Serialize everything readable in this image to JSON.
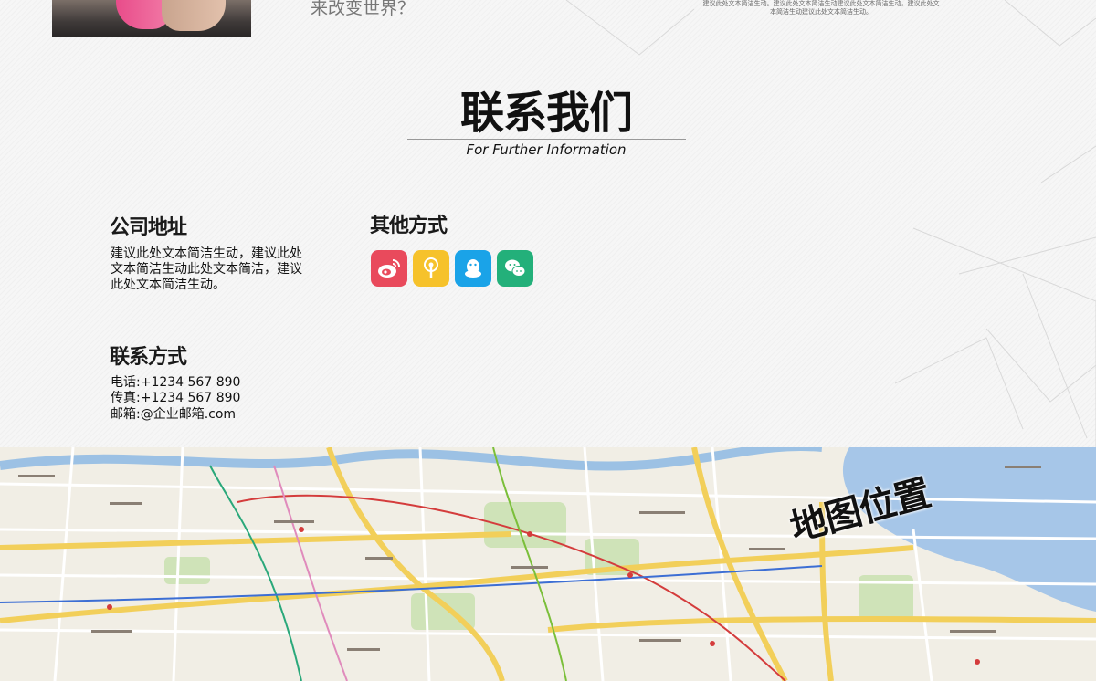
{
  "top": {
    "tagline": "来改变世界？",
    "tiny_text": "建议此处文本简洁生动。建议此处文本简洁生动建议此处文本简洁生动，建议此处文本简洁生动建议此处文本简洁生动。"
  },
  "section": {
    "title": "联系我们",
    "subtitle": "For Further Information"
  },
  "address": {
    "heading": "公司地址",
    "text": "建议此处文本简洁生动，建议此处文本简洁生动此处文本简洁，建议此处文本简洁生动。"
  },
  "other": {
    "heading": "其他方式",
    "icons": [
      {
        "name": "weibo-icon",
        "color": "#e94a5c"
      },
      {
        "name": "podcast-icon",
        "color": "#f6c22b"
      },
      {
        "name": "qq-icon",
        "color": "#1aa3e8"
      },
      {
        "name": "wechat-icon",
        "color": "#23b07a"
      }
    ]
  },
  "contact": {
    "heading": "联系方式",
    "phone": "电话:+1234 567 890",
    "fax": "传真:+1234 567 890",
    "email": "邮箱:@企业邮箱.com"
  },
  "map": {
    "label": "地图位置"
  }
}
